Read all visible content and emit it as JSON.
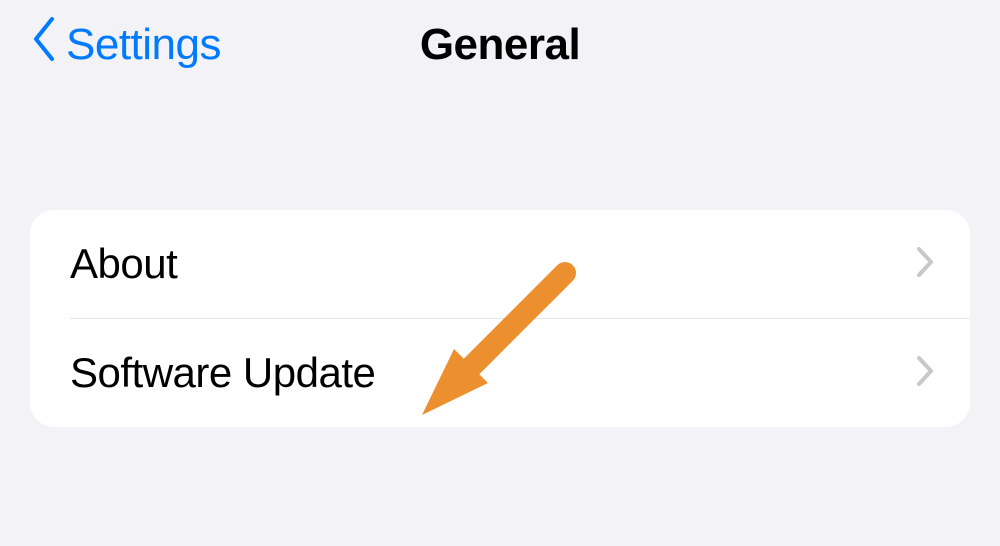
{
  "nav": {
    "back_label": "Settings",
    "title": "General"
  },
  "list": {
    "items": [
      {
        "label": "About"
      },
      {
        "label": "Software Update"
      }
    ]
  }
}
